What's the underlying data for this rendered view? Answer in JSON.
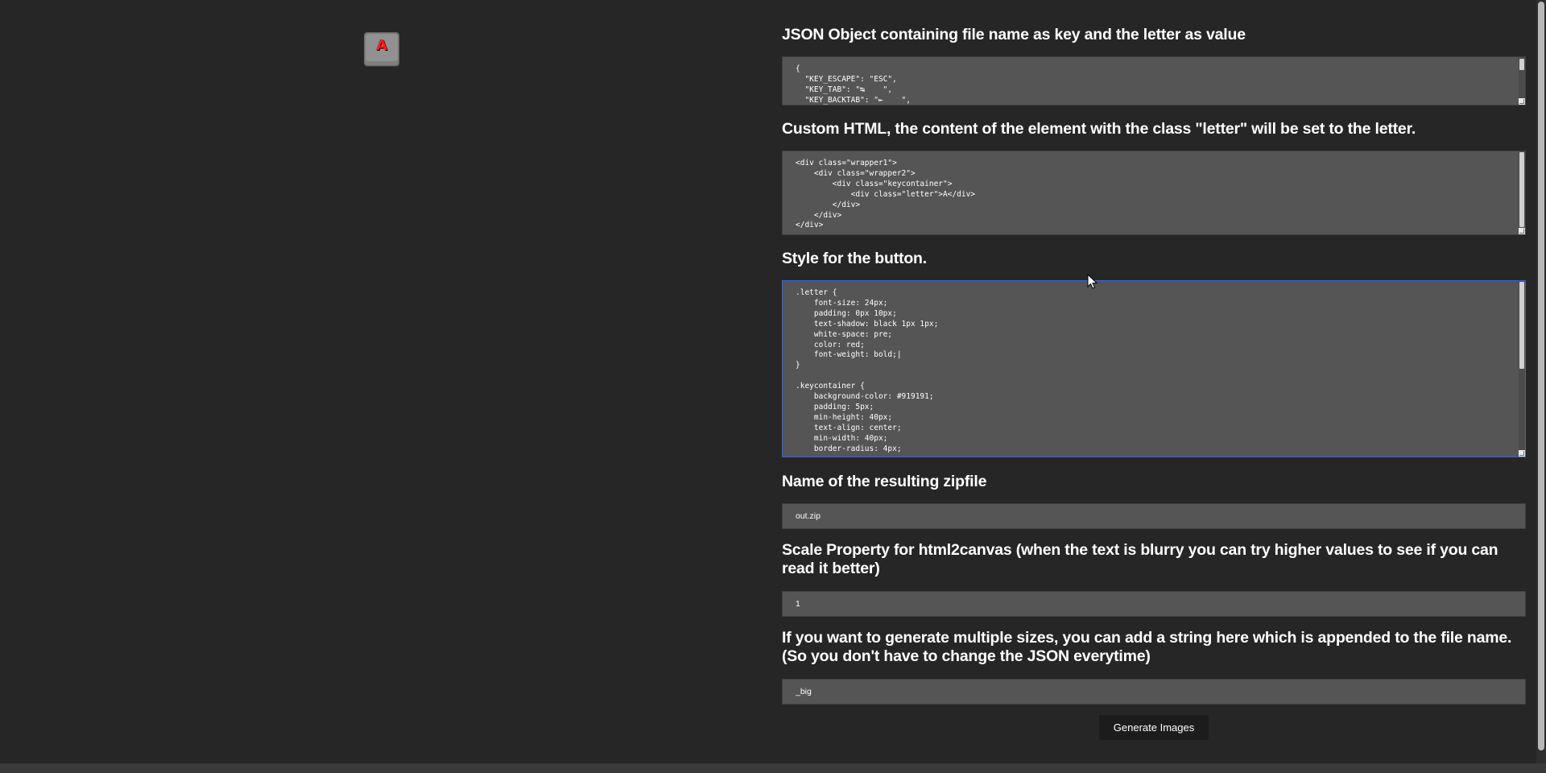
{
  "preview": {
    "letter": "A"
  },
  "form": {
    "json_label": "JSON Object containing file name as key and the letter as value",
    "json_content": "{\n  \"KEY_ESCAPE\": \"ESC\",\n  \"KEY_TAB\": \"↹    \",\n  \"KEY_BACKTAB\": \"⇤    \",",
    "html_label": "Custom HTML, the content of the element with the class \"letter\" will be set to the letter.",
    "html_content": "<div class=\"wrapper1\">\n    <div class=\"wrapper2\">\n        <div class=\"keycontainer\">\n            <div class=\"letter\">A</div>\n        </div>\n    </div>\n</div>",
    "style_label": "Style for the button.",
    "style_content": ".letter {\n    font-size: 24px;\n    padding: 0px 10px;\n    text-shadow: black 1px 1px;\n    white-space: pre;\n    color: red;\n    font-weight: bold;|\n}\n\n.keycontainer {\n    background-color: #919191;\n    padding: 5px;\n    min-height: 40px;\n    text-align: center;\n    min-width: 40px;\n    border-radius: 4px;",
    "zip_label": "Name of the resulting zipfile",
    "zip_value": "out.zip",
    "scale_label": "Scale Property for html2canvas (when the text is blurry you can try higher values to see if you can read it better)",
    "scale_value": "1",
    "suffix_label": "If you want to generate multiple sizes, you can add a string here which is appended to the file name. (So you don't have to change the JSON everytime)",
    "suffix_value": "_big",
    "generate_label": "Generate Images"
  },
  "colors": {
    "background": "#262626",
    "field": "#555555",
    "focus_border": "#3c64c8",
    "button": "#1c1c1c",
    "letter": "#ff1a1a"
  }
}
